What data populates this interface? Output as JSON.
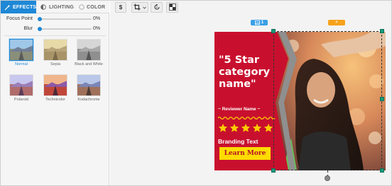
{
  "tabs": [
    {
      "label": "EFFECTS",
      "icon": "wand-icon",
      "active": true
    },
    {
      "label": "LIGHTING",
      "icon": "half-circle-icon",
      "active": false
    },
    {
      "label": "COLOR",
      "icon": "dotted-circle-icon",
      "active": false
    }
  ],
  "sliders": {
    "focus": {
      "label": "Focus Point",
      "value": "0%",
      "level": 0
    },
    "blur": {
      "label": "Blur",
      "value": "0%",
      "level": 0
    }
  },
  "filters": [
    {
      "label": "Normal",
      "selected": true
    },
    {
      "label": "Sepia",
      "selected": false
    },
    {
      "label": "Black and White",
      "selected": false
    },
    {
      "label": "Polaroid",
      "selected": false
    },
    {
      "label": "Technicolor",
      "selected": false
    },
    {
      "label": "Kodachrome",
      "selected": false
    }
  ],
  "toolbar": {
    "dollar_label": "$",
    "crop_icon": "crop-icon",
    "rotate_icon": "rotate-icon",
    "grid_icon": "checker-icon"
  },
  "tags": {
    "image_number": "1",
    "add_label": "+"
  },
  "ad": {
    "heading": "\"5 Star category name\"",
    "reviewer": "~ Reviewer Name ~",
    "stars": 5,
    "branding": "Branding Text",
    "cta": "Learn More"
  },
  "colors": {
    "accent": "#1e88d6",
    "ad_red": "#c8102e",
    "cta_yellow": "#ffdc00",
    "star_yellow": "#ffcc00",
    "handle_green": "#1b9c7d",
    "tag_orange": "#f6a21a"
  }
}
